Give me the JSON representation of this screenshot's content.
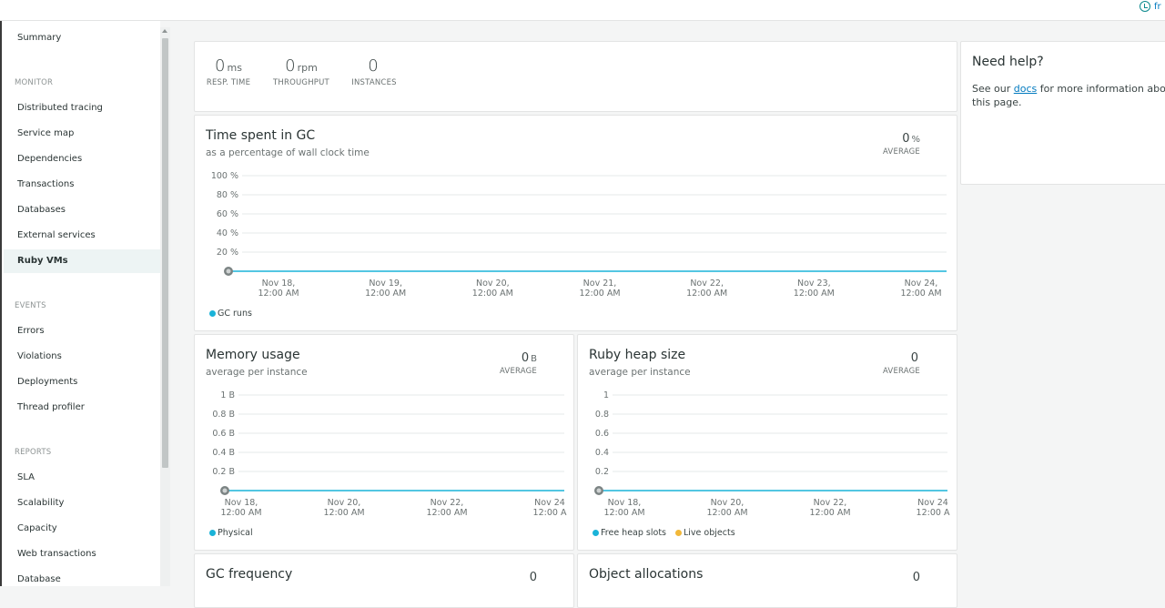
{
  "topbar": {
    "time_label": "fr"
  },
  "sidebar": {
    "summary": "Summary",
    "monitor_section": "MONITOR",
    "monitor": [
      "Distributed tracing",
      "Service map",
      "Dependencies",
      "Transactions",
      "Databases",
      "External services",
      "Ruby VMs"
    ],
    "events_section": "EVENTS",
    "events": [
      "Errors",
      "Violations",
      "Deployments",
      "Thread profiler"
    ],
    "reports_section": "REPORTS",
    "reports": [
      "SLA",
      "Scalability",
      "Capacity",
      "Web transactions",
      "Database"
    ],
    "active": "Ruby VMs"
  },
  "summary_metrics": [
    {
      "value": "0",
      "unit": "ms",
      "label": "RESP. TIME"
    },
    {
      "value": "0",
      "unit": "rpm",
      "label": "THROUGHPUT"
    },
    {
      "value": "0",
      "unit": "",
      "label": "INSTANCES"
    }
  ],
  "gc_time": {
    "title": "Time spent in GC",
    "subtitle": "as a percentage of wall clock time",
    "avg_value": "0",
    "avg_unit": "%",
    "avg_label": "AVERAGE",
    "y_ticks": [
      "100 %",
      "80 %",
      "60 %",
      "40 %",
      "20 %"
    ],
    "x_ticks": [
      [
        "Nov 18,",
        "12:00 AM"
      ],
      [
        "Nov 19,",
        "12:00 AM"
      ],
      [
        "Nov 20,",
        "12:00 AM"
      ],
      [
        "Nov 21,",
        "12:00 AM"
      ],
      [
        "Nov 22,",
        "12:00 AM"
      ],
      [
        "Nov 23,",
        "12:00 AM"
      ],
      [
        "Nov 24,",
        "12:00 AM"
      ]
    ],
    "legend": [
      {
        "name": "GC runs",
        "color": "#1ab3d8"
      }
    ]
  },
  "memory": {
    "title": "Memory usage",
    "subtitle": "average per instance",
    "avg_value": "0",
    "avg_unit": "B",
    "avg_label": "AVERAGE",
    "y_ticks": [
      "1 B",
      "0.8 B",
      "0.6 B",
      "0.4 B",
      "0.2 B"
    ],
    "x_ticks": [
      [
        "Nov 18,",
        "12:00 AM"
      ],
      [
        "Nov 20,",
        "12:00 AM"
      ],
      [
        "Nov 22,",
        "12:00 AM"
      ],
      [
        "Nov 24",
        "12:00 A"
      ]
    ],
    "legend": [
      {
        "name": "Physical",
        "color": "#1ab3d8"
      }
    ]
  },
  "heap": {
    "title": "Ruby heap size",
    "subtitle": "average per instance",
    "avg_value": "0",
    "avg_unit": "",
    "avg_label": "AVERAGE",
    "y_ticks": [
      "1",
      "0.8",
      "0.6",
      "0.4",
      "0.2"
    ],
    "x_ticks": [
      [
        "Nov 18,",
        "12:00 AM"
      ],
      [
        "Nov 20,",
        "12:00 AM"
      ],
      [
        "Nov 22,",
        "12:00 AM"
      ],
      [
        "Nov 24",
        "12:00 A"
      ]
    ],
    "legend": [
      {
        "name": "Free heap slots",
        "color": "#1ab3d8"
      },
      {
        "name": "Live objects",
        "color": "#f2b83a"
      }
    ]
  },
  "gc_frequency": {
    "title": "GC frequency",
    "avg_value": "0"
  },
  "object_alloc": {
    "title": "Object allocations",
    "avg_value": "0"
  },
  "help": {
    "title": "Need help?",
    "text_before": "See our ",
    "link": "docs",
    "text_after": " for more information about this page."
  },
  "colors": {
    "accent": "#1ab3d8",
    "brand": "#0d8a8e"
  }
}
